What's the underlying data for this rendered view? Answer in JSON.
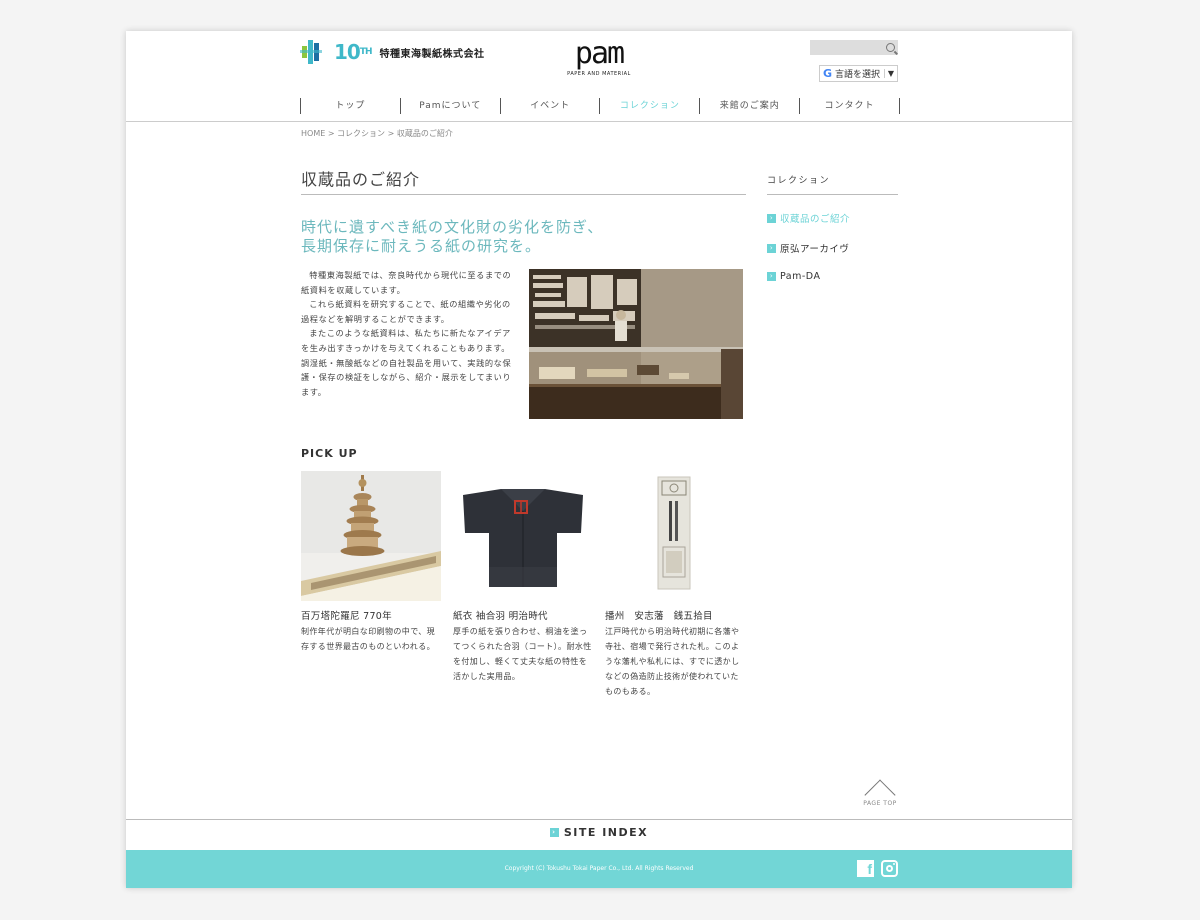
{
  "header": {
    "logo_anniv_number": "10",
    "logo_anniv_suffix": "TH",
    "company_name": "特種東海製紙株式会社",
    "pam_word": "pam",
    "pam_sub": "PAPER AND MATERIAL",
    "search": {
      "placeholder": ""
    },
    "language_select": "言語を選択",
    "language_arrow": "▼"
  },
  "nav": {
    "items": [
      {
        "label": "トップ"
      },
      {
        "label": "Pamについて"
      },
      {
        "label": "イベント"
      },
      {
        "label": "コレクション"
      },
      {
        "label": "来館のご案内"
      },
      {
        "label": "コンタクト"
      }
    ],
    "active_index": 3
  },
  "breadcrumb": "HOME > コレクション > 収蔵品のご紹介",
  "main": {
    "title": "収蔵品のご紹介",
    "lead_line1": "時代に遺すべき紙の文化財の劣化を防ぎ、",
    "lead_line2": "長期保存に耐えうる紙の研究を。",
    "body_p1": "特種東海製紙では、奈良時代から現代に至るまでの紙資料を収蔵しています。",
    "body_p2": "これら紙資料を研究することで、紙の組織や劣化の過程などを解明することができます。",
    "body_p3": "またこのような紙資料は、私たちに新たなアイデアを生み出すきっかけを与えてくれることもあります。調湿紙・無酸紙などの自社製品を用いて、実践的な保護・保存の検証をしながら、紹介・展示をしてまいります。"
  },
  "pickup": {
    "title": "PICK UP",
    "items": [
      {
        "name": "百万塔陀羅尼 770年",
        "desc": "制作年代が明白な印刷物の中で、現存する世界最古のものといわれる。"
      },
      {
        "name": "紙衣 袖合羽 明治時代",
        "desc": "厚手の紙を張り合わせ、桐油を塗ってつくられた合羽（コート）。耐水性を付加し、軽くて丈夫な紙の特性を活かした実用品。"
      },
      {
        "name": "播州　安志藩　銭五拾目",
        "desc": "江戸時代から明治時代初期に各藩や寺社、宿場で発行された札。このような藩札や私札には、すでに透かしなどの偽造防止技術が使われていたものもある。"
      }
    ]
  },
  "sidebar": {
    "title": "コレクション",
    "items": [
      {
        "label": "収蔵品のご紹介",
        "active": true
      },
      {
        "label": "原弘アーカイヴ",
        "active": false
      },
      {
        "label": "Pam-DA",
        "active": false
      }
    ]
  },
  "page_top": "PAGE TOP",
  "footer": {
    "site_index": "SITE INDEX",
    "copyright": "Copyright (C) Tokushu Tokai Paper Co., Ltd. All Rights Reserved",
    "fb_glyph": "f"
  },
  "colors": {
    "accent": "#6cd3d6",
    "footer_bg": "#72d6d6",
    "lead_text": "#6cb8bd"
  }
}
